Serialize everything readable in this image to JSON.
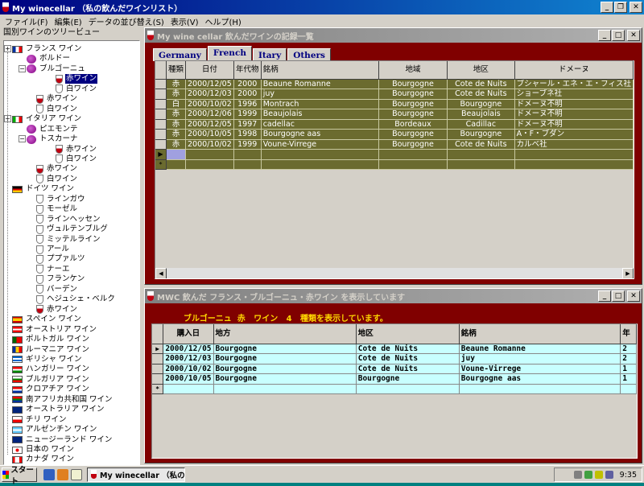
{
  "app": {
    "title": "My winecellar  （私の飲んだワインリスト）"
  },
  "menu": [
    "ファイル(F)",
    "編集(E)",
    "データの並び替え(S)",
    "表示(V)",
    "ヘルプ(H)"
  ],
  "tree": {
    "header": "国別ワインのツリービュー",
    "nodes": [
      {
        "label": "フランス ワイン",
        "x": 0,
        "icon": "flag-fr"
      },
      {
        "label": "ボルドー",
        "x": 1,
        "icon": "grape"
      },
      {
        "label": "ブルゴーニュ",
        "x": 1,
        "icon": "grape"
      },
      {
        "label": "赤ワイン",
        "x": 3,
        "icon": "red",
        "sel": true
      },
      {
        "label": "白ワイン",
        "x": 3,
        "icon": "white"
      },
      {
        "label": "赤ワイン",
        "x": 2,
        "icon": "red"
      },
      {
        "label": "白ワイン",
        "x": 2,
        "icon": "white"
      },
      {
        "label": "イタリア ワイン",
        "x": 0,
        "icon": "flag-it"
      },
      {
        "label": "ピエモンテ",
        "x": 1,
        "icon": "grape"
      },
      {
        "label": "トスカーナ",
        "x": 1,
        "icon": "grape"
      },
      {
        "label": "赤ワイン",
        "x": 3,
        "icon": "red"
      },
      {
        "label": "白ワイン",
        "x": 3,
        "icon": "white"
      },
      {
        "label": "赤ワイン",
        "x": 2,
        "icon": "red"
      },
      {
        "label": "白ワイン",
        "x": 2,
        "icon": "white"
      },
      {
        "label": "ドイツ ワイン",
        "x": 0,
        "icon": "flag-de"
      },
      {
        "label": "ラインガウ",
        "x": 2,
        "icon": "white"
      },
      {
        "label": "モーゼル",
        "x": 2,
        "icon": "white"
      },
      {
        "label": "ラインヘッセン",
        "x": 2,
        "icon": "white"
      },
      {
        "label": "ヴュルテンブルグ",
        "x": 2,
        "icon": "white"
      },
      {
        "label": "ミッテルライン",
        "x": 2,
        "icon": "white"
      },
      {
        "label": "アール",
        "x": 2,
        "icon": "white"
      },
      {
        "label": "ププァルツ",
        "x": 2,
        "icon": "white"
      },
      {
        "label": "ナーエ",
        "x": 2,
        "icon": "white"
      },
      {
        "label": "フランケン",
        "x": 2,
        "icon": "white"
      },
      {
        "label": "バーデン",
        "x": 2,
        "icon": "white"
      },
      {
        "label": "ヘジュシェ・ベルク",
        "x": 2,
        "icon": "white"
      },
      {
        "label": "赤ワイン",
        "x": 2,
        "icon": "red"
      },
      {
        "label": "スペイン ワイン",
        "x": 0,
        "icon": "flag-es"
      },
      {
        "label": "オーストリア ワイン",
        "x": 0,
        "icon": "flag-at"
      },
      {
        "label": "ポルトガル ワイン",
        "x": 0,
        "icon": "flag-pt"
      },
      {
        "label": "ルーマニア ワイン",
        "x": 0,
        "icon": "flag-ro"
      },
      {
        "label": "ギリシャ ワイン",
        "x": 0,
        "icon": "flag-gr"
      },
      {
        "label": "ハンガリー ワイン",
        "x": 0,
        "icon": "flag-hu"
      },
      {
        "label": "ブルガリア ワイン",
        "x": 0,
        "icon": "flag-bg"
      },
      {
        "label": "クロアチア ワイン",
        "x": 0,
        "icon": "flag-hr"
      },
      {
        "label": "南アフリカ共和国 ワイン",
        "x": 0,
        "icon": "flag-za"
      },
      {
        "label": "オーストラリア ワイン",
        "x": 0,
        "icon": "flag-au"
      },
      {
        "label": "チリ ワイン",
        "x": 0,
        "icon": "flag-cl"
      },
      {
        "label": "アルゼンチン ワイン",
        "x": 0,
        "icon": "flag-ar"
      },
      {
        "label": "ニュージーランド ワイン",
        "x": 0,
        "icon": "flag-nz"
      },
      {
        "label": "日本の ワイン",
        "x": 0,
        "icon": "flag-jp"
      },
      {
        "label": "カナダ ワイン",
        "x": 0,
        "icon": "flag-ca"
      }
    ]
  },
  "win1": {
    "title": "My wine cellar  飲んだワインの記録一覧",
    "tabs": [
      "Germany",
      "French",
      "Itary",
      "Others"
    ],
    "active_tab": 1,
    "columns": [
      "種類",
      "日付",
      "年代物",
      "銘柄",
      "地域",
      "地区",
      "ドメーヌ"
    ],
    "rows": [
      [
        "赤",
        "2000/12/05",
        "2000",
        "Beaune Romanne",
        "Bourgogne",
        "Cote de Nuits",
        "ブシャール・エネ・エ・フィス社"
      ],
      [
        "赤",
        "2000/12/03",
        "2000",
        "juy",
        "Bourgogne",
        "Cote de Nuits",
        "ショーブネ社"
      ],
      [
        "白",
        "2000/10/02",
        "1996",
        "Montrach",
        "Bourgogne",
        "Bourgogne",
        "ドメーヌ不明"
      ],
      [
        "赤",
        "2000/12/06",
        "1999",
        "Beaujolais",
        "Bourgogne",
        "Beaujolais",
        "ドメーヌ不明"
      ],
      [
        "赤",
        "2000/12/05",
        "1997",
        "cadellac",
        "Bordeaux",
        "Cadillac",
        "ドメーヌ不明"
      ],
      [
        "赤",
        "2000/10/05",
        "1998",
        "Bourgogne aas",
        "Bourgogne",
        "Bourgogne",
        "A・F・ブダン"
      ],
      [
        "赤",
        "2000/10/02",
        "1999",
        "Voune-Virrege",
        "Bourgogne",
        "Cote de Nuits",
        "カルベ社"
      ]
    ]
  },
  "win2": {
    "title": "MWC 飲んだ フランス・ブルゴーニュ・赤ワイン を表示しています",
    "banner": "ブルゴーニュ  赤   ワイン   4   種類を表示しています。",
    "columns": [
      "購入日",
      "地方",
      "地区",
      "銘柄",
      "年"
    ],
    "rows": [
      [
        "2000/12/05",
        "Bourgogne",
        "Cote de Nuits",
        "Beaune Romanne",
        "2"
      ],
      [
        "2000/12/03",
        "Bourgogne",
        "Cote de Nuits",
        "juy",
        "2"
      ],
      [
        "2000/10/02",
        "Bourgogne",
        "Cote de Nuits",
        "Voune-Virrege",
        "1"
      ],
      [
        "2000/10/05",
        "Bourgogne",
        "Bourgogne",
        "Bourgogne aas",
        "1"
      ]
    ]
  },
  "taskbar": {
    "start": "スタート",
    "task": "My winecellar （私の...",
    "clock": "9:35"
  }
}
